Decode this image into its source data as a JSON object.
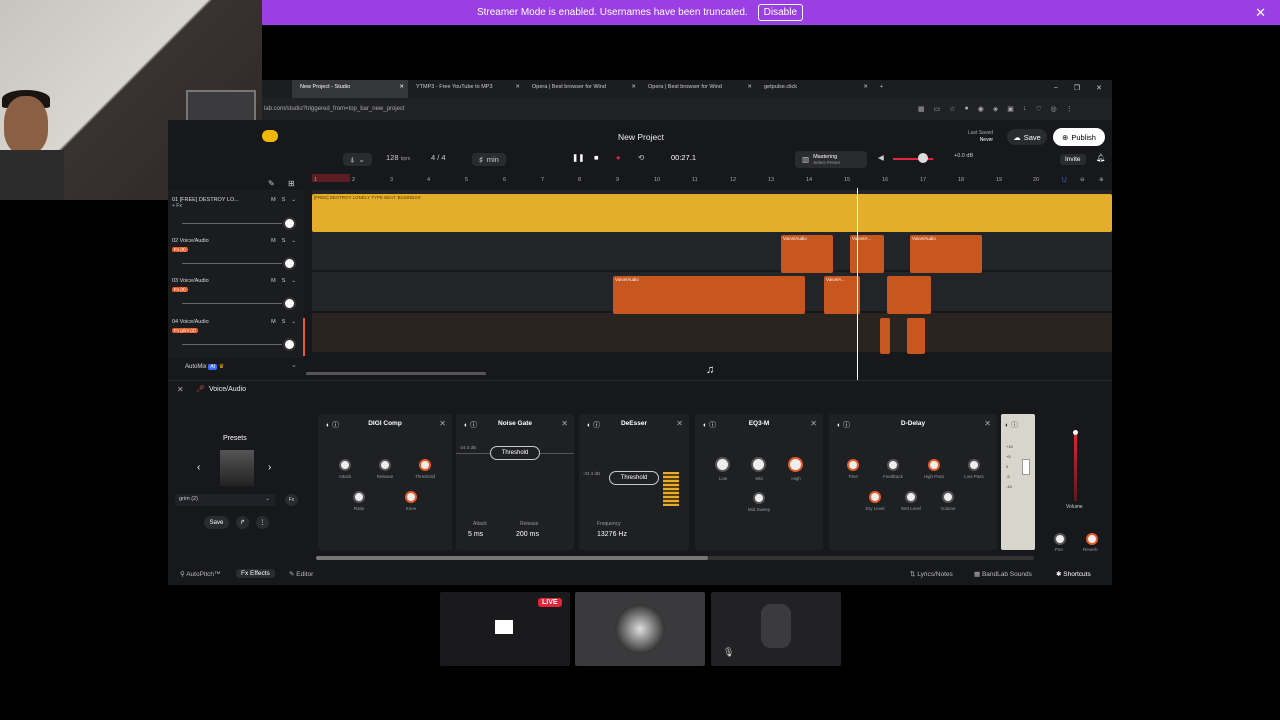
{
  "banner": {
    "text": "Streamer Mode is enabled. Usernames have been truncated.",
    "button": "Disable",
    "close": "✕"
  },
  "browser": {
    "tabs": [
      {
        "label": "New Project - Studio",
        "active": true
      },
      {
        "label": "YTMP3 - Free YouTube to MP3"
      },
      {
        "label": "Opera | Best browser for Wind"
      },
      {
        "label": "Opera | Best browser for Wind"
      },
      {
        "label": "getpulse.click"
      }
    ],
    "url": "lab.com/studio?triggered_from=top_bar_new_project",
    "new_tab": "+"
  },
  "app": {
    "project_title": "New Project",
    "last_saved_label": "Last Saved",
    "last_saved_value": "Never",
    "save": "Save",
    "publish": "Publish",
    "invite": "Invite",
    "tempo": "128",
    "tempo_unit": "bpm",
    "signature": "4 / 4",
    "key": "min",
    "time": "00:27.1",
    "mastering": "Mastering",
    "mastering_sub": "Select Preset",
    "master_db": "+0.0 dB",
    "ruler": [
      "1",
      "2",
      "3",
      "4",
      "5",
      "6",
      "7",
      "8",
      "9",
      "10",
      "11",
      "12",
      "13",
      "14",
      "15",
      "16",
      "17",
      "18",
      "19",
      "20"
    ]
  },
  "tracks": [
    {
      "name": "01 [FREE] DESTROY LO...",
      "badge": "+ Fx",
      "m": "M",
      "s": "S"
    },
    {
      "name": "02 Voice/Audio",
      "badge": "Fx (0)",
      "m": "M",
      "s": "S"
    },
    {
      "name": "03 Voice/Audio",
      "badge": "Fx (0)",
      "m": "M",
      "s": "S"
    },
    {
      "name": "04 Voice/Audio",
      "badge": "Fx grim (2)",
      "m": "M",
      "s": "S"
    }
  ],
  "clips": {
    "beat": "[FREE] DESTROY LONELY TYPE BEAT 'BUSINESS'",
    "voice": "Voice/Audio",
    "voice_short": "Voice/A..."
  },
  "automix": "AutoMix",
  "automix_badge": "AI",
  "fx": {
    "track_title": "Voice/Audio",
    "presets": "Presets",
    "preset_value": "grim (2)",
    "save": "Save",
    "close": "✕",
    "cards": {
      "digicomp": {
        "title": "DIGI Comp",
        "knobs": [
          "Attack",
          "Release",
          "Threshold",
          "Ratio",
          "Knee"
        ]
      },
      "noisegate": {
        "title": "Noise Gate",
        "threshold": "Threshold",
        "db": "-34.0 dB",
        "attack_label": "Attack",
        "attack": "5 ms",
        "release_label": "Release",
        "release": "200 ms"
      },
      "deesser": {
        "title": "DeEsser",
        "threshold": "Threshold",
        "db": "-34.3 dB",
        "freq_label": "Frequency",
        "freq": "13276 Hz"
      },
      "eq": {
        "title": "EQ3-M",
        "knobs": [
          "Low",
          "Mid",
          "High",
          "Mid Sweep"
        ]
      },
      "delay": {
        "title": "D-Delay",
        "knobs": [
          "Time",
          "Feedback",
          "High Pass",
          "Low Pass",
          "Dry Level",
          "Wet Level",
          "Volume"
        ]
      }
    },
    "volume": "Volume",
    "pan": "Pan",
    "reverb": "Reverb",
    "meter": [
      "+15",
      "+5",
      "0",
      "-5",
      "-15"
    ]
  },
  "bottom": {
    "autopitch": "AutoPitch™",
    "effects": "Effects",
    "editor": "Editor",
    "lyrics": "Lyrics/Notes",
    "sounds": "BandLab Sounds",
    "shortcuts": "Shortcuts"
  },
  "live": "LIVE",
  "colors": {
    "banner": "#9a3fe3",
    "accent": "#e85a27",
    "beat": "#e4ad2b",
    "live": "#e3243b"
  }
}
